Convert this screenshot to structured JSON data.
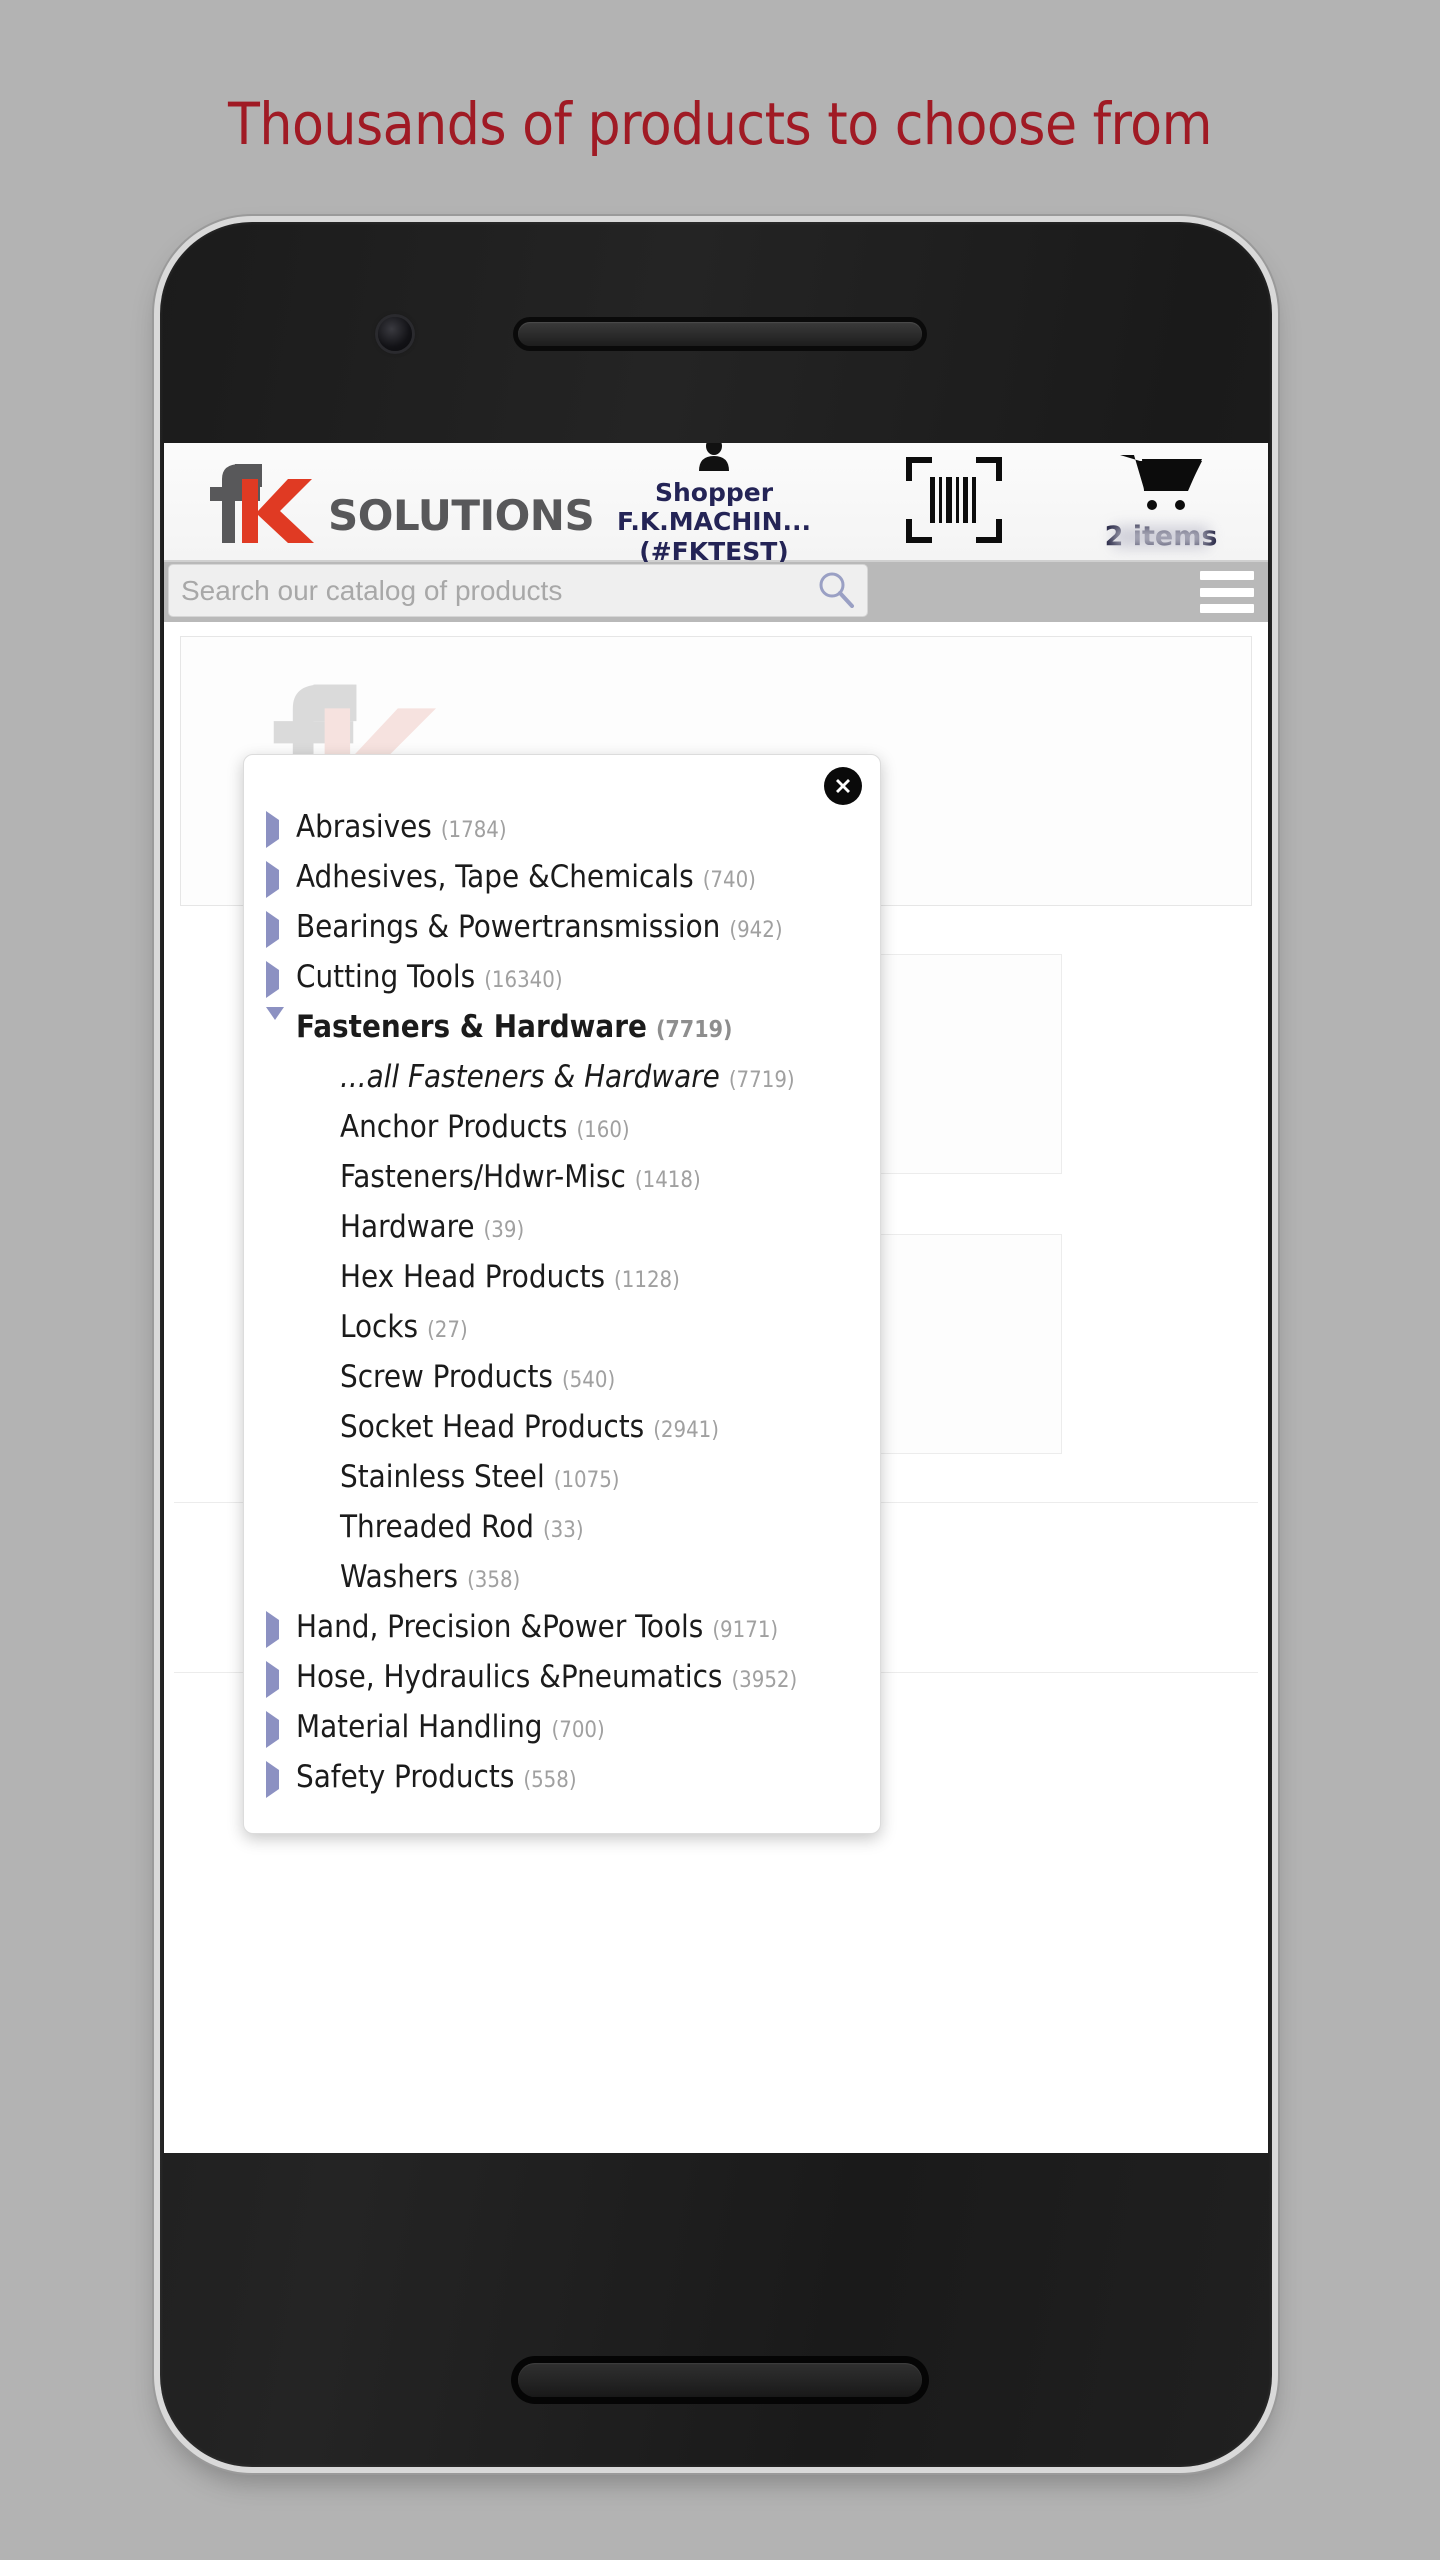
{
  "promo": {
    "title": "Thousands of products to choose from"
  },
  "header": {
    "brand_word": "SOLUTIONS",
    "shopper_label": "Shopper",
    "shopper_name": "F.K.MACHIN...",
    "shopper_account": "(#FKTEST)",
    "barcode_icon": "barcode-scan-icon",
    "cart_icon": "shopping-cart-icon",
    "cart_count": "2 items",
    "person_icon": "person-icon",
    "brand_accent": "#e03a23",
    "brand_gray": "#58585a",
    "shopper_color": "#242456"
  },
  "search": {
    "placeholder": "Search our catalog of products",
    "value": "",
    "search_icon": "magnifier-icon",
    "menu_icon": "hamburger-menu-icon"
  },
  "modal": {
    "close_icon": "close-icon",
    "categories": [
      {
        "label": "Abrasives",
        "count": "(1784)",
        "state": "collapsed",
        "level": "top"
      },
      {
        "label": "Adhesives, Tape &Chemicals",
        "count": "(740)",
        "state": "collapsed",
        "level": "top"
      },
      {
        "label": "Bearings & Powertransmission",
        "count": "(942)",
        "state": "collapsed",
        "level": "top"
      },
      {
        "label": "Cutting Tools",
        "count": "(16340)",
        "state": "collapsed",
        "level": "top"
      },
      {
        "label": "Fasteners & Hardware",
        "count": "(7719)",
        "state": "expanded",
        "level": "top"
      },
      {
        "label": "...all Fasteners & Hardware",
        "count": "(7719)",
        "state": "leaf",
        "level": "sub",
        "italic": true
      },
      {
        "label": "Anchor Products",
        "count": "(160)",
        "state": "leaf",
        "level": "sub"
      },
      {
        "label": "Fasteners/Hdwr-Misc",
        "count": "(1418)",
        "state": "leaf",
        "level": "sub"
      },
      {
        "label": "Hardware",
        "count": "(39)",
        "state": "leaf",
        "level": "sub"
      },
      {
        "label": "Hex Head Products",
        "count": "(1128)",
        "state": "leaf",
        "level": "sub"
      },
      {
        "label": "Locks",
        "count": "(27)",
        "state": "leaf",
        "level": "sub"
      },
      {
        "label": "Screw Products",
        "count": "(540)",
        "state": "leaf",
        "level": "sub"
      },
      {
        "label": "Socket Head Products",
        "count": "(2941)",
        "state": "leaf",
        "level": "sub"
      },
      {
        "label": "Stainless Steel",
        "count": "(1075)",
        "state": "leaf",
        "level": "sub"
      },
      {
        "label": "Threaded Rod",
        "count": "(33)",
        "state": "leaf",
        "level": "sub"
      },
      {
        "label": "Washers",
        "count": "(358)",
        "state": "leaf",
        "level": "sub"
      },
      {
        "label": "Hand, Precision &Power Tools",
        "count": "(9171)",
        "state": "collapsed",
        "level": "top"
      },
      {
        "label": "Hose, Hydraulics &Pneumatics",
        "count": "(3952)",
        "state": "collapsed",
        "level": "top"
      },
      {
        "label": "Material Handling",
        "count": "(700)",
        "state": "collapsed",
        "level": "top"
      },
      {
        "label": "Safety Products",
        "count": "(558)",
        "state": "collapsed",
        "level": "top"
      }
    ]
  },
  "colors": {
    "background": "#b3b3b3",
    "promo_red": "#a01a24",
    "triangle": "#8c91c2",
    "count_gray": "#a0a0a0"
  }
}
